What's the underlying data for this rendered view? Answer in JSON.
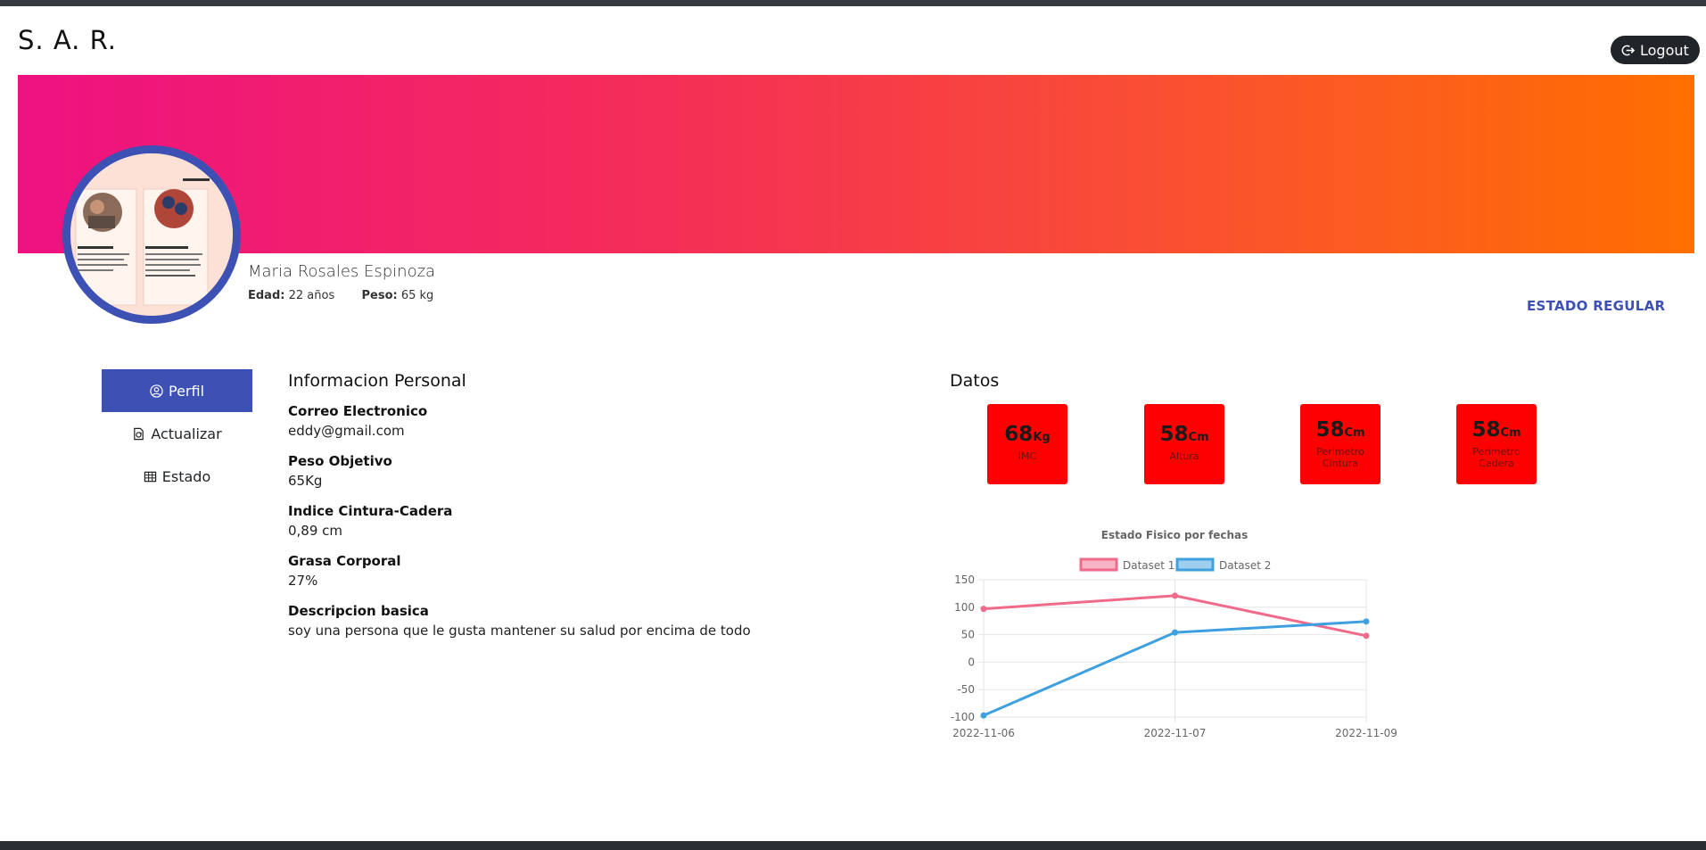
{
  "header": {
    "brand": "S. A. R.",
    "logout_label": "Logout"
  },
  "profile": {
    "name": "Maria Rosales Espinoza",
    "age_label": "Edad:",
    "age_value": "22 años",
    "weight_label": "Peso:",
    "weight_value": "65 kg",
    "status": "ESTADO REGULAR"
  },
  "nav": {
    "items": [
      {
        "label": "Perfil",
        "icon": "user-circle-icon",
        "active": true
      },
      {
        "label": "Actualizar",
        "icon": "file-refresh-icon",
        "active": false
      },
      {
        "label": "Estado",
        "icon": "table-icon",
        "active": false
      }
    ]
  },
  "info": {
    "title": "Informacion Personal",
    "fields": [
      {
        "label": "Correo Electronico",
        "value": "eddy@gmail.com"
      },
      {
        "label": "Peso Objetivo",
        "value": "65Kg"
      },
      {
        "label": "Indice Cintura-Cadera",
        "value": "0,89 cm"
      },
      {
        "label": "Grasa Corporal",
        "value": "27%"
      },
      {
        "label": "Descripcion basica",
        "value": "soy una persona que le gusta mantener su salud por encima de todo"
      }
    ]
  },
  "datos": {
    "title": "Datos",
    "cards": [
      {
        "value": "68",
        "unit": "Kg",
        "label": "IMC"
      },
      {
        "value": "58",
        "unit": "Cm",
        "label": "Altura"
      },
      {
        "value": "58",
        "unit": "Cm",
        "label": "Perimetro Cintura"
      },
      {
        "value": "58",
        "unit": "Cm",
        "label": "Perimetro Cadera"
      }
    ],
    "card_color": "#ff0000"
  },
  "colors": {
    "accent": "#3d51b4",
    "banner_start": "#ee1181",
    "banner_end": "#ff6f00"
  },
  "chart_data": {
    "type": "line",
    "title": "Estado Fisico por fechas",
    "xlabel": "",
    "ylabel": "",
    "categories": [
      "2022-11-06",
      "2022-11-07",
      "2022-11-09"
    ],
    "series": [
      {
        "name": "Dataset 1",
        "values": [
          97,
          121,
          48
        ],
        "color": "#f06a8a"
      },
      {
        "name": "Dataset 2",
        "values": [
          -97,
          54,
          74
        ],
        "color": "#3fa0e0"
      }
    ],
    "ylim": [
      -100,
      150
    ],
    "yticks": [
      150,
      100,
      50,
      0,
      -50,
      -100
    ],
    "grid": true,
    "legend": "top"
  }
}
